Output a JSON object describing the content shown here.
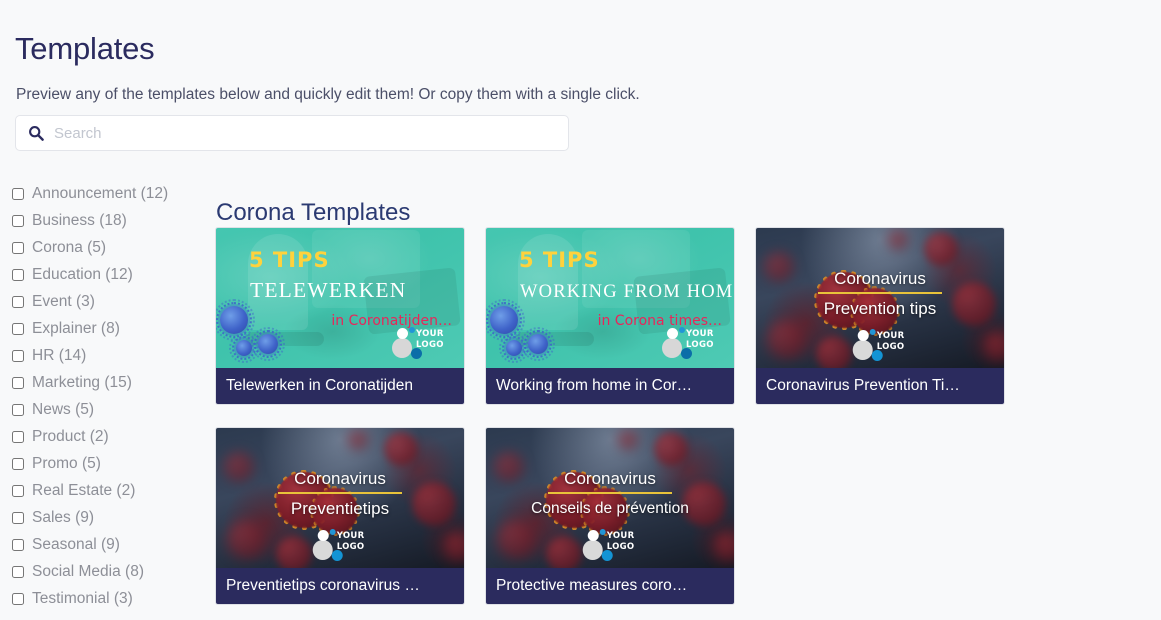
{
  "header": {
    "title": "Templates",
    "subtitle": "Preview any of the templates below and quickly edit them! Or copy them with a single click."
  },
  "search": {
    "icon": "search-icon",
    "placeholder": "Search",
    "value": ""
  },
  "colors": {
    "page_background": "#f8f9fa",
    "title": "#2b2b5f",
    "section_title": "#2b3a72",
    "caption_bar": "#2b2b5e",
    "filter_label": "#8d8f97",
    "teal_thumb": "#3fc3ac",
    "tips_yellow": "#ffd23c",
    "accent_pink": "#e8265a",
    "rule_yellow": "#e8c33a"
  },
  "filters": {
    "items": [
      {
        "label": "Announcement (12)",
        "name": "announcement",
        "checked": false
      },
      {
        "label": "Business (18)",
        "name": "business",
        "checked": false
      },
      {
        "label": "Corona (5)",
        "name": "corona",
        "checked": false
      },
      {
        "label": "Education (12)",
        "name": "education",
        "checked": false
      },
      {
        "label": "Event (3)",
        "name": "event",
        "checked": false
      },
      {
        "label": "Explainer (8)",
        "name": "explainer",
        "checked": false
      },
      {
        "label": "HR (14)",
        "name": "hr",
        "checked": false
      },
      {
        "label": "Marketing (15)",
        "name": "marketing",
        "checked": false
      },
      {
        "label": "News (5)",
        "name": "news",
        "checked": false
      },
      {
        "label": "Product (2)",
        "name": "product",
        "checked": false
      },
      {
        "label": "Promo (5)",
        "name": "promo",
        "checked": false
      },
      {
        "label": "Real Estate (2)",
        "name": "real-estate",
        "checked": false
      },
      {
        "label": "Sales (9)",
        "name": "sales",
        "checked": false
      },
      {
        "label": "Seasonal (9)",
        "name": "seasonal",
        "checked": false
      },
      {
        "label": "Social Media (8)",
        "name": "social-media",
        "checked": false
      },
      {
        "label": "Testimonial (3)",
        "name": "testimonial",
        "checked": false
      }
    ]
  },
  "main": {
    "section_title": "Corona Templates",
    "cards": [
      {
        "style": "teal",
        "caption": "Telewerken in Coronatijden",
        "thumb": {
          "tips": "5 TIPS",
          "headline": "TELEWERKEN",
          "subline": "in Coronatijden…",
          "logo_line1": "YOUR",
          "logo_line2": "LOGO"
        }
      },
      {
        "style": "teal",
        "caption": "Working from home in Cor…",
        "thumb": {
          "tips": "5 TIPS",
          "headline": "WORKING FROM HOME",
          "subline": "in Corona times…",
          "logo_line1": "YOUR",
          "logo_line2": "LOGO"
        }
      },
      {
        "style": "dark",
        "caption": "Coronavirus Prevention Ti…",
        "thumb": {
          "title": "Coronavirus",
          "subtitle": "Prevention tips",
          "logo_line1": "YOUR",
          "logo_line2": "LOGO"
        }
      },
      {
        "style": "dark",
        "caption": "Preventietips coronavirus …",
        "thumb": {
          "title": "Coronavirus",
          "subtitle": "Preventietips",
          "logo_line1": "YOUR",
          "logo_line2": "LOGO"
        }
      },
      {
        "style": "dark",
        "caption": "Protective measures coro…",
        "thumb": {
          "title": "Coronavirus",
          "subtitle": "Conseils de prévention",
          "logo_line1": "YOUR",
          "logo_line2": "LOGO"
        }
      }
    ]
  }
}
